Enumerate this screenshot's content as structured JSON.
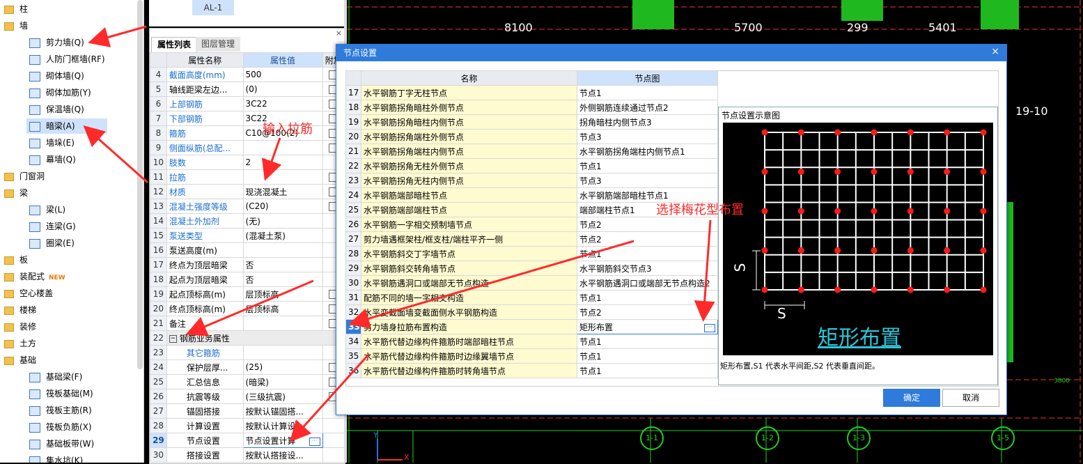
{
  "tree": {
    "items": [
      {
        "label": "柱",
        "level": 0
      },
      {
        "label": "墙",
        "level": 0
      },
      {
        "label": "剪力墙(Q)",
        "level": 1
      },
      {
        "label": "人防门框墙(RF)",
        "level": 1
      },
      {
        "label": "砌体墙(Q)",
        "level": 1
      },
      {
        "label": "砌体加筋(Y)",
        "level": 1
      },
      {
        "label": "保温墙(Q)",
        "level": 1
      },
      {
        "label": "暗梁(A)",
        "level": 1,
        "selected": true
      },
      {
        "label": "墙垛(E)",
        "level": 1
      },
      {
        "label": "幕墙(Q)",
        "level": 1
      },
      {
        "label": "门窗洞",
        "level": 0
      },
      {
        "label": "梁",
        "level": 0
      },
      {
        "label": "梁(L)",
        "level": 1
      },
      {
        "label": "连梁(G)",
        "level": 1
      },
      {
        "label": "圈梁(E)",
        "level": 1
      },
      {
        "label": "板",
        "level": 0
      },
      {
        "label": "装配式",
        "level": 0,
        "badge": "NEW"
      },
      {
        "label": "空心楼盖",
        "level": 0
      },
      {
        "label": "楼梯",
        "level": 0
      },
      {
        "label": "装修",
        "level": 0
      },
      {
        "label": "土方",
        "level": 0
      },
      {
        "label": "基础",
        "level": 0
      },
      {
        "label": "基础梁(F)",
        "level": 1
      },
      {
        "label": "筏板基础(M)",
        "level": 1
      },
      {
        "label": "筏板主筋(R)",
        "level": 1
      },
      {
        "label": "筏板负筋(X)",
        "level": 1
      },
      {
        "label": "基础板带(W)",
        "level": 1
      },
      {
        "label": "集水坑(K)",
        "level": 1
      }
    ]
  },
  "wall_list": {
    "selected": "AL-1"
  },
  "props": {
    "close_label": "×",
    "tabs": [
      "属性列表",
      "图层管理"
    ],
    "headers": [
      "",
      "属性名称",
      "属性值",
      "附加"
    ],
    "rows": [
      {
        "num": "4",
        "name": "截面高度(mm)",
        "value": "500",
        "blue": true,
        "check": true
      },
      {
        "num": "5",
        "name": "轴线距梁左边...",
        "value": "(0)",
        "blue": false,
        "check": true
      },
      {
        "num": "6",
        "name": "上部钢筋",
        "value": "3C22",
        "blue": true,
        "check": true
      },
      {
        "num": "7",
        "name": "下部钢筋",
        "value": "3C22",
        "blue": true,
        "check": true
      },
      {
        "num": "8",
        "name": "箍筋",
        "value": "C10@100(2)",
        "blue": true,
        "check": true
      },
      {
        "num": "9",
        "name": "侧面纵筋(总配...",
        "value": "",
        "blue": true,
        "check": true
      },
      {
        "num": "10",
        "name": "肢数",
        "value": "2",
        "blue": true,
        "check": false
      },
      {
        "num": "11",
        "name": "拉筋",
        "value": "",
        "blue": true,
        "check": true
      },
      {
        "num": "12",
        "name": "材质",
        "value": "现浇混凝土",
        "blue": true,
        "check": true
      },
      {
        "num": "13",
        "name": "混凝土强度等级",
        "value": "(C20)",
        "blue": true,
        "check": true
      },
      {
        "num": "14",
        "name": "混凝土外加剂",
        "value": "(无)",
        "blue": true,
        "check": false
      },
      {
        "num": "15",
        "name": "泵送类型",
        "value": "(混凝土泵)",
        "blue": true,
        "check": false
      },
      {
        "num": "16",
        "name": "泵送高度(m)",
        "value": "",
        "blue": false,
        "check": false
      },
      {
        "num": "17",
        "name": "终点为顶层暗梁",
        "value": "否",
        "blue": false,
        "check": false
      },
      {
        "num": "18",
        "name": "起点为顶层暗梁",
        "value": "否",
        "blue": false,
        "check": false
      },
      {
        "num": "19",
        "name": "起点顶标高(m)",
        "value": "层顶标高",
        "blue": false,
        "check": true
      },
      {
        "num": "20",
        "name": "终点顶标高(m)",
        "value": "层顶标高",
        "blue": false,
        "check": true
      },
      {
        "num": "21",
        "name": "备注",
        "value": "",
        "blue": false,
        "check": true
      },
      {
        "num": "22",
        "name": "钢筋业务属性",
        "value": "",
        "group": true
      },
      {
        "num": "23",
        "name": "其它箍筋",
        "value": "",
        "blue": true,
        "indent": true
      },
      {
        "num": "24",
        "name": "保护层厚...",
        "value": "(25)",
        "indent": true,
        "check": true
      },
      {
        "num": "25",
        "name": "汇总信息",
        "value": "(暗梁)",
        "indent": true,
        "check": true
      },
      {
        "num": "26",
        "name": "抗震等级",
        "value": "(三级抗震)",
        "indent": true,
        "check": true
      },
      {
        "num": "27",
        "name": "锚固搭接",
        "value": "按默认锚固搭...",
        "indent": true
      },
      {
        "num": "28",
        "name": "计算设置",
        "value": "按默认计算设...",
        "indent": true
      },
      {
        "num": "29",
        "name": "节点设置",
        "value": "节点设置计算",
        "indent": true,
        "selected": true,
        "ellipsis": true
      },
      {
        "num": "30",
        "name": "搭接设置",
        "value": "按默认搭接设...",
        "indent": true
      }
    ]
  },
  "cad": {
    "dims": [
      "8100",
      "5700",
      "299",
      "5401"
    ],
    "axis_label": "19-10",
    "dim_small": "3800",
    "axes": [
      "1-1",
      "1-2",
      "1-3",
      "1-5"
    ],
    "x_label": "X",
    "y_label": "Y"
  },
  "dialog": {
    "title": "节点设置",
    "close": "×",
    "headers": [
      "",
      "名称",
      "节点图"
    ],
    "rows": [
      {
        "num": "17",
        "name": "水平钢筋丁字无柱节点",
        "value": "节点1"
      },
      {
        "num": "18",
        "name": "水平钢筋拐角暗柱外侧节点",
        "value": "外侧钢筋连续通过节点2"
      },
      {
        "num": "19",
        "name": "水平钢筋拐角暗柱内侧节点",
        "value": "拐角暗柱内侧节点3"
      },
      {
        "num": "20",
        "name": "水平钢筋拐角端柱外侧节点",
        "value": "节点3"
      },
      {
        "num": "21",
        "name": "水平钢筋拐角端柱内侧节点",
        "value": "水平钢筋拐角端柱内侧节点1"
      },
      {
        "num": "22",
        "name": "水平钢筋拐角无柱外侧节点",
        "value": "节点1"
      },
      {
        "num": "23",
        "name": "水平钢筋拐角无柱内侧节点",
        "value": "节点3"
      },
      {
        "num": "24",
        "name": "水平钢筋端部暗柱节点",
        "value": "水平钢筋端部暗柱节点1"
      },
      {
        "num": "25",
        "name": "水平钢筋端部端柱节点",
        "value": "端部端柱节点1"
      },
      {
        "num": "26",
        "name": "水平钢筋一字相交预制墙节点",
        "value": "节点2"
      },
      {
        "num": "27",
        "name": "剪力墙遇框架柱/框支柱/端柱平齐一侧",
        "value": "节点2"
      },
      {
        "num": "28",
        "name": "水平钢筋斜交丁字墙节点",
        "value": "节点1"
      },
      {
        "num": "29",
        "name": "水平钢筋斜交转角墙节点",
        "value": "水平钢筋斜交节点3"
      },
      {
        "num": "30",
        "name": "水平钢筋遇洞口或端部无节点构造",
        "value": "水平钢筋遇洞口或端部无节点构造2"
      },
      {
        "num": "31",
        "name": "配筋不同的墙一字相交构造",
        "value": "节点1"
      },
      {
        "num": "32",
        "name": "水平变截面墙变截面侧水平钢筋构造",
        "value": "节点2"
      },
      {
        "num": "33",
        "name": "剪力墙身拉筋布置构造",
        "value": "矩形布置",
        "selected": true
      },
      {
        "num": "34",
        "name": "水平筋代替边缘构件箍筋时端部暗柱节点",
        "value": "节点1"
      },
      {
        "num": "35",
        "name": "水平筋代替边缘构件箍筋时边缘翼墙节点",
        "value": "节点1"
      },
      {
        "num": "36",
        "name": "水平筋代替边缘构件箍筋时转角墙节点",
        "value": "节点1"
      }
    ],
    "diagram_title": "节点设置示意图",
    "diagram_s_label": "S",
    "diagram_name": "矩形布置",
    "diagram_caption": "矩形布置,S1 代表水平间距,S2 代表垂直间距。",
    "ok": "确定",
    "cancel": "取消"
  },
  "annotations": {
    "a1": "输入拉筋",
    "a2": "选择梅花型布置"
  },
  "colors": {
    "accent": "#2f7bdc",
    "annotation": "#ff2a2a",
    "cad_green": "#1fb81f"
  }
}
